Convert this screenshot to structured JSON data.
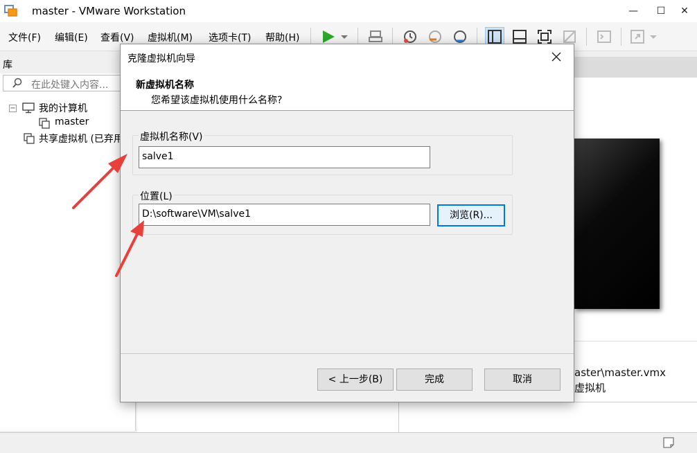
{
  "window": {
    "title": "master - VMware Workstation",
    "minimize": "—",
    "maximize": "☐",
    "close": "✕"
  },
  "menu": [
    {
      "label": "文件(F)"
    },
    {
      "label": "编辑(E)"
    },
    {
      "label": "查看(V)"
    },
    {
      "label": "虚拟机(M)"
    },
    {
      "label": "选项卡(T)"
    },
    {
      "label": "帮助(H)"
    }
  ],
  "library": {
    "title": "库",
    "search_placeholder": "在此处键入内容...",
    "tree": {
      "my_computer": "我的计算机",
      "vm": "master",
      "shared": "共享虚拟机 (已弃用)"
    }
  },
  "background": {
    "vmx_path": "aster\\master.vmx",
    "vm_text": "虚拟机"
  },
  "dialog": {
    "title": "克隆虚拟机向导",
    "header_title": "新虚拟机名称",
    "header_subtitle": "您希望该虚拟机使用什么名称?",
    "name_label": "虚拟机名称(V)",
    "name_value": "salve1",
    "location_label": "位置(L)",
    "location_value": "D:\\software\\VM\\salve1",
    "browse_button": "浏览(R)...",
    "back_button": "< 上一步(B)",
    "finish_button": "完成",
    "cancel_button": "取消"
  },
  "colors": {
    "accent": "#0078d7",
    "play": "#2ea82e",
    "arrow": "#e8403a"
  }
}
